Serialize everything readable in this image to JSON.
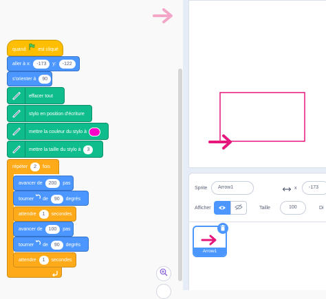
{
  "blocks": {
    "when_flag": {
      "pre": "quand",
      "post": "est cliqué"
    },
    "goto": {
      "label": "aller à x:",
      "x": "-173",
      "ylabel": "y:",
      "y": "-122"
    },
    "point": {
      "label": "s'orienter à",
      "value": "90"
    },
    "clear": {
      "label": "effacer tout"
    },
    "pen_down": {
      "label": "stylo en position d'écriture"
    },
    "set_color": {
      "label": "mettre la couleur du stylo à"
    },
    "set_size": {
      "label": "mettre la taille du stylo à",
      "value": "3"
    },
    "repeat": {
      "label": "répéter",
      "value": "2",
      "post": "fois"
    },
    "move1": {
      "label": "avancer de",
      "value": "200",
      "post": "pas"
    },
    "turn1": {
      "label": "tourner",
      "mid": "de",
      "value": "90",
      "post": "degrés"
    },
    "wait1": {
      "label": "attendre",
      "value": "1",
      "post": "secondes"
    },
    "move2": {
      "label": "avancer de",
      "value": "100",
      "post": "pas"
    },
    "turn2": {
      "label": "tourner",
      "mid": "de",
      "value": "90",
      "post": "degrés"
    },
    "wait2": {
      "label": "attendre",
      "value": "1",
      "post": "secondes"
    }
  },
  "colors": {
    "pen_color": "#ff00c8",
    "arrow": "#e6167d",
    "arrow_faded": "#f4a6c8"
  },
  "sprite_info": {
    "sprite_label": "Sprite",
    "sprite_name": "Arrow1",
    "x_label": "x",
    "x_value": "-173",
    "show_label": "Afficher",
    "size_label": "Taille",
    "size_value": "100",
    "direction_label_partial": "Di"
  },
  "sprite_list": {
    "items": [
      {
        "name": "Arrow1",
        "selected": true
      }
    ]
  }
}
